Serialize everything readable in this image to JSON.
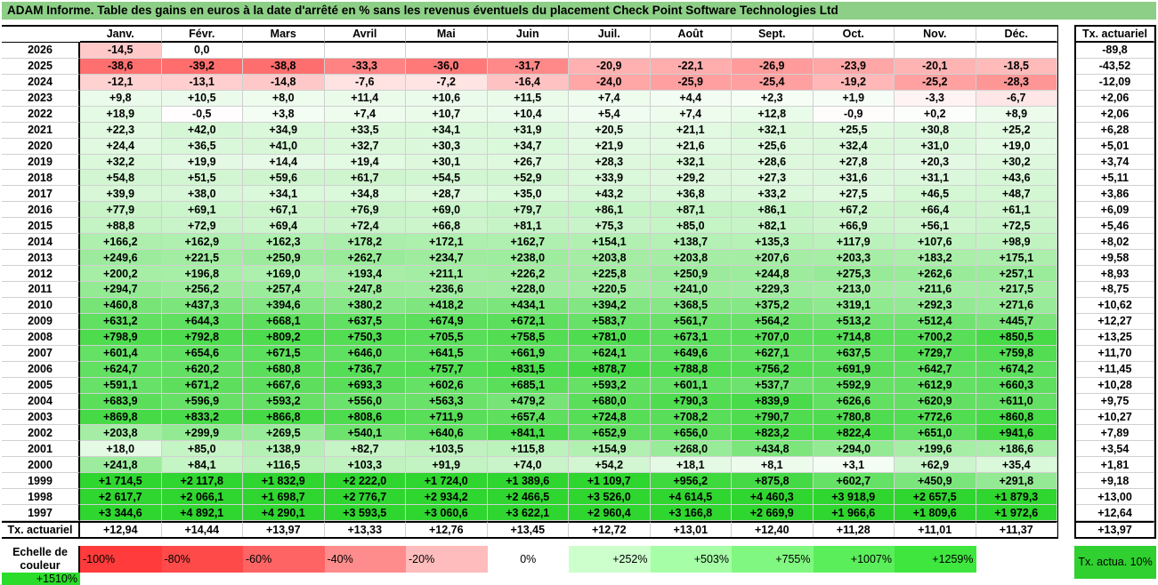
{
  "title": "ADAM Informe. Table des gains en euros à la date d'arrêté en % sans les revenus éventuels du placement Check Point Software Technologies Ltd",
  "months": [
    "Janv.",
    "Févr.",
    "Mars",
    "Avril",
    "Mai",
    "Juin",
    "Juil.",
    "Août",
    "Sept.",
    "Oct.",
    "Nov.",
    "Déc."
  ],
  "actuarial_header": "Tx. actuariel",
  "rows": [
    {
      "year": "2026",
      "values": [
        "-14,5",
        "0,0",
        "",
        "",
        "",
        "",
        "",
        "",
        "",
        "",
        "",
        ""
      ],
      "rate": "-89,8"
    },
    {
      "year": "2025",
      "values": [
        "-38,6",
        "-39,2",
        "-38,8",
        "-33,3",
        "-36,0",
        "-31,7",
        "-20,9",
        "-22,1",
        "-26,9",
        "-23,9",
        "-20,1",
        "-18,5"
      ],
      "rate": "-43,52"
    },
    {
      "year": "2024",
      "values": [
        "-12,1",
        "-13,1",
        "-14,8",
        "-7,6",
        "-7,2",
        "-16,4",
        "-24,0",
        "-25,9",
        "-25,4",
        "-19,2",
        "-25,2",
        "-28,3"
      ],
      "rate": "-12,09"
    },
    {
      "year": "2023",
      "values": [
        "+9,8",
        "+10,5",
        "+8,0",
        "+11,4",
        "+10,6",
        "+11,5",
        "+7,4",
        "+4,4",
        "+2,3",
        "+1,9",
        "-3,3",
        "-6,7"
      ],
      "rate": "+2,06"
    },
    {
      "year": "2022",
      "values": [
        "+18,9",
        "-0,5",
        "+3,8",
        "+7,4",
        "+10,7",
        "+10,4",
        "+5,4",
        "+7,4",
        "+12,8",
        "-0,9",
        "+0,2",
        "+8,9"
      ],
      "rate": "+2,06"
    },
    {
      "year": "2021",
      "values": [
        "+22,3",
        "+42,0",
        "+34,9",
        "+33,5",
        "+34,1",
        "+31,9",
        "+20,5",
        "+21,1",
        "+32,1",
        "+25,5",
        "+30,8",
        "+25,2"
      ],
      "rate": "+6,28"
    },
    {
      "year": "2020",
      "values": [
        "+24,4",
        "+36,5",
        "+41,0",
        "+32,7",
        "+30,3",
        "+34,7",
        "+21,9",
        "+21,6",
        "+25,6",
        "+32,4",
        "+31,0",
        "+19,0"
      ],
      "rate": "+5,01"
    },
    {
      "year": "2019",
      "values": [
        "+32,2",
        "+19,9",
        "+14,4",
        "+19,4",
        "+30,1",
        "+26,7",
        "+28,3",
        "+32,1",
        "+28,6",
        "+27,8",
        "+20,3",
        "+30,2"
      ],
      "rate": "+3,74"
    },
    {
      "year": "2018",
      "values": [
        "+54,8",
        "+51,5",
        "+59,6",
        "+61,7",
        "+54,5",
        "+52,9",
        "+33,9",
        "+29,2",
        "+27,3",
        "+31,6",
        "+31,1",
        "+43,6"
      ],
      "rate": "+5,11"
    },
    {
      "year": "2017",
      "values": [
        "+39,9",
        "+38,0",
        "+34,1",
        "+34,8",
        "+28,7",
        "+35,0",
        "+43,2",
        "+36,8",
        "+33,2",
        "+27,5",
        "+46,5",
        "+48,7"
      ],
      "rate": "+3,86"
    },
    {
      "year": "2016",
      "values": [
        "+77,9",
        "+69,1",
        "+67,1",
        "+76,9",
        "+69,0",
        "+79,7",
        "+86,1",
        "+87,1",
        "+86,1",
        "+67,2",
        "+66,4",
        "+61,1"
      ],
      "rate": "+6,09"
    },
    {
      "year": "2015",
      "values": [
        "+88,8",
        "+72,9",
        "+69,4",
        "+72,4",
        "+66,8",
        "+81,1",
        "+75,3",
        "+85,0",
        "+82,1",
        "+66,9",
        "+56,1",
        "+72,5"
      ],
      "rate": "+5,46"
    },
    {
      "year": "2014",
      "values": [
        "+166,2",
        "+162,9",
        "+162,3",
        "+178,2",
        "+172,1",
        "+162,7",
        "+154,1",
        "+138,7",
        "+135,3",
        "+117,9",
        "+107,6",
        "+98,9"
      ],
      "rate": "+8,02"
    },
    {
      "year": "2013",
      "values": [
        "+249,6",
        "+221,5",
        "+250,9",
        "+262,7",
        "+234,7",
        "+238,0",
        "+203,8",
        "+203,8",
        "+207,6",
        "+203,3",
        "+183,2",
        "+175,1"
      ],
      "rate": "+9,58"
    },
    {
      "year": "2012",
      "values": [
        "+200,2",
        "+196,8",
        "+169,0",
        "+193,4",
        "+211,1",
        "+226,2",
        "+225,8",
        "+250,9",
        "+244,8",
        "+275,3",
        "+262,6",
        "+257,1"
      ],
      "rate": "+8,93"
    },
    {
      "year": "2011",
      "values": [
        "+294,7",
        "+256,2",
        "+257,4",
        "+247,8",
        "+236,6",
        "+228,0",
        "+220,5",
        "+241,0",
        "+229,3",
        "+213,0",
        "+211,6",
        "+217,5"
      ],
      "rate": "+8,75"
    },
    {
      "year": "2010",
      "values": [
        "+460,8",
        "+437,3",
        "+394,6",
        "+380,2",
        "+418,2",
        "+434,1",
        "+394,2",
        "+368,5",
        "+375,2",
        "+319,1",
        "+292,3",
        "+271,6"
      ],
      "rate": "+10,62"
    },
    {
      "year": "2009",
      "values": [
        "+631,2",
        "+644,3",
        "+668,1",
        "+637,5",
        "+674,9",
        "+672,1",
        "+583,7",
        "+561,7",
        "+564,2",
        "+513,2",
        "+512,4",
        "+445,7"
      ],
      "rate": "+12,27"
    },
    {
      "year": "2008",
      "values": [
        "+798,9",
        "+792,8",
        "+809,2",
        "+750,3",
        "+705,5",
        "+758,5",
        "+781,0",
        "+673,1",
        "+707,0",
        "+714,8",
        "+700,2",
        "+850,5"
      ],
      "rate": "+13,25"
    },
    {
      "year": "2007",
      "values": [
        "+601,4",
        "+654,6",
        "+671,5",
        "+646,0",
        "+641,5",
        "+661,9",
        "+624,1",
        "+649,6",
        "+627,1",
        "+637,5",
        "+729,7",
        "+759,8"
      ],
      "rate": "+11,70"
    },
    {
      "year": "2006",
      "values": [
        "+624,7",
        "+620,2",
        "+680,8",
        "+736,7",
        "+757,7",
        "+831,5",
        "+878,7",
        "+788,8",
        "+756,2",
        "+691,9",
        "+642,7",
        "+674,2"
      ],
      "rate": "+11,45"
    },
    {
      "year": "2005",
      "values": [
        "+591,1",
        "+671,2",
        "+667,6",
        "+693,3",
        "+602,6",
        "+685,1",
        "+593,2",
        "+601,1",
        "+537,7",
        "+592,9",
        "+612,9",
        "+660,3"
      ],
      "rate": "+10,28"
    },
    {
      "year": "2004",
      "values": [
        "+683,9",
        "+596,9",
        "+593,2",
        "+556,0",
        "+563,3",
        "+479,2",
        "+680,0",
        "+790,3",
        "+839,9",
        "+626,6",
        "+620,9",
        "+611,0"
      ],
      "rate": "+9,75"
    },
    {
      "year": "2003",
      "values": [
        "+869,8",
        "+833,2",
        "+866,8",
        "+808,6",
        "+711,9",
        "+657,4",
        "+724,8",
        "+708,2",
        "+790,7",
        "+780,8",
        "+772,6",
        "+860,8"
      ],
      "rate": "+10,27"
    },
    {
      "year": "2002",
      "values": [
        "+203,8",
        "+299,9",
        "+269,5",
        "+540,1",
        "+640,6",
        "+841,1",
        "+652,9",
        "+656,0",
        "+823,2",
        "+822,4",
        "+651,0",
        "+941,6"
      ],
      "rate": "+7,89"
    },
    {
      "year": "2001",
      "values": [
        "+18,0",
        "+85,0",
        "+138,9",
        "+82,7",
        "+103,5",
        "+115,8",
        "+154,9",
        "+268,0",
        "+434,8",
        "+294,0",
        "+199,6",
        "+186,6"
      ],
      "rate": "+3,54"
    },
    {
      "year": "2000",
      "values": [
        "+241,8",
        "+84,1",
        "+116,5",
        "+103,3",
        "+91,9",
        "+74,0",
        "+54,2",
        "+18,1",
        "+8,1",
        "+3,1",
        "+62,9",
        "+35,4"
      ],
      "rate": "+1,81"
    },
    {
      "year": "1999",
      "values": [
        "+1 714,5",
        "+2 117,8",
        "+1 832,9",
        "+2 222,0",
        "+1 724,0",
        "+1 389,6",
        "+1 109,7",
        "+956,2",
        "+875,8",
        "+602,7",
        "+450,9",
        "+291,8"
      ],
      "rate": "+9,18"
    },
    {
      "year": "1998",
      "values": [
        "+2 617,7",
        "+2 066,1",
        "+1 698,7",
        "+2 776,7",
        "+2 934,2",
        "+2 466,5",
        "+3 526,0",
        "+4 614,5",
        "+4 460,3",
        "+3 918,9",
        "+2 657,5",
        "+1 879,3"
      ],
      "rate": "+13,00"
    },
    {
      "year": "1997",
      "values": [
        "+3 344,6",
        "+4 892,1",
        "+4 290,1",
        "+3 593,5",
        "+3 060,6",
        "+3 622,1",
        "+2 960,4",
        "+3 166,8",
        "+2 669,9",
        "+1 966,6",
        "+1 809,6",
        "+1 972,6"
      ],
      "rate": "+12,64"
    }
  ],
  "totals": {
    "label": "Tx. actuariel",
    "values": [
      "+12,94",
      "+14,44",
      "+13,97",
      "+13,33",
      "+12,76",
      "+13,45",
      "+12,72",
      "+13,01",
      "+12,40",
      "+11,28",
      "+11,01",
      "+11,37"
    ],
    "rate": "+13,97"
  },
  "legend": {
    "title": "Echelle de couleur",
    "items": [
      {
        "label": "-100%",
        "color": "#ff3b3b",
        "align": "left"
      },
      {
        "label": "-80%",
        "color": "#ff4a4a",
        "align": "left"
      },
      {
        "label": "-60%",
        "color": "#ff6464",
        "align": "left"
      },
      {
        "label": "-40%",
        "color": "#ff8c8c",
        "align": "left"
      },
      {
        "label": "-20%",
        "color": "#ffbcbc",
        "align": "left"
      },
      {
        "label": "0%",
        "color": "#ffffff",
        "align": "center"
      },
      {
        "label": "+252%",
        "color": "#ccffcc",
        "align": "right"
      },
      {
        "label": "+503%",
        "color": "#a6ffa6",
        "align": "right"
      },
      {
        "label": "+755%",
        "color": "#80f780",
        "align": "right"
      },
      {
        "label": "+1007%",
        "color": "#5aee5a",
        "align": "right"
      },
      {
        "label": "+1259%",
        "color": "#3ee63e",
        "align": "right"
      },
      {
        "label": "+1510%",
        "color": "#2bdc2b",
        "align": "right"
      }
    ],
    "box_label": "Tx. actua. 10%"
  }
}
